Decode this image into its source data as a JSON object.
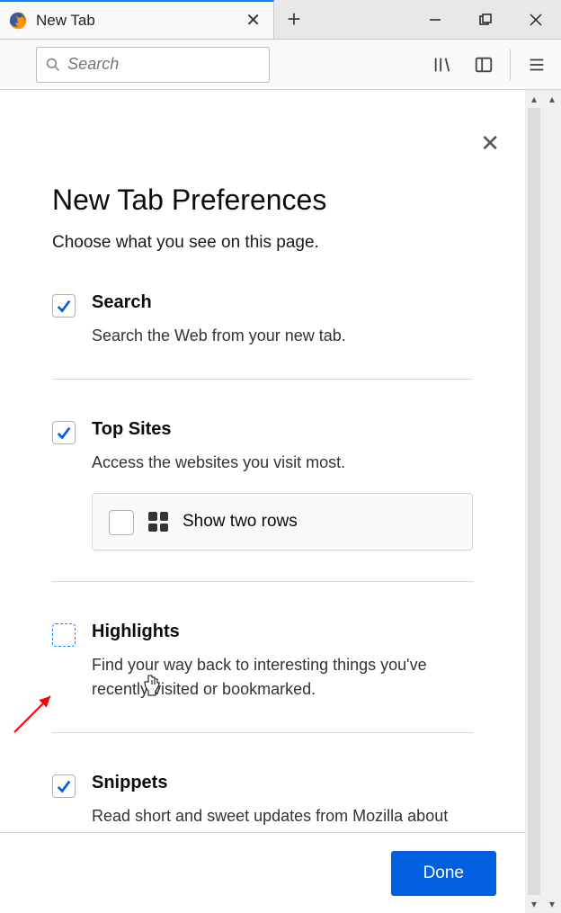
{
  "tab": {
    "title": "New Tab"
  },
  "search": {
    "placeholder": "Search"
  },
  "prefs": {
    "title": "New Tab Preferences",
    "subtitle": "Choose what you see on this page.",
    "options": [
      {
        "title": "Search",
        "desc": "Search the Web from your new tab.",
        "checked": true
      },
      {
        "title": "Top Sites",
        "desc": "Access the websites you visit most.",
        "checked": true,
        "subopt": {
          "label": "Show two rows",
          "checked": false
        }
      },
      {
        "title": "Highlights",
        "desc": "Find your way back to interesting things you've recently visited or bookmarked.",
        "checked": false
      },
      {
        "title": "Snippets",
        "desc": "Read short and sweet updates from Mozilla about Firefox, internet culture, and the",
        "checked": true
      }
    ],
    "done": "Done"
  }
}
